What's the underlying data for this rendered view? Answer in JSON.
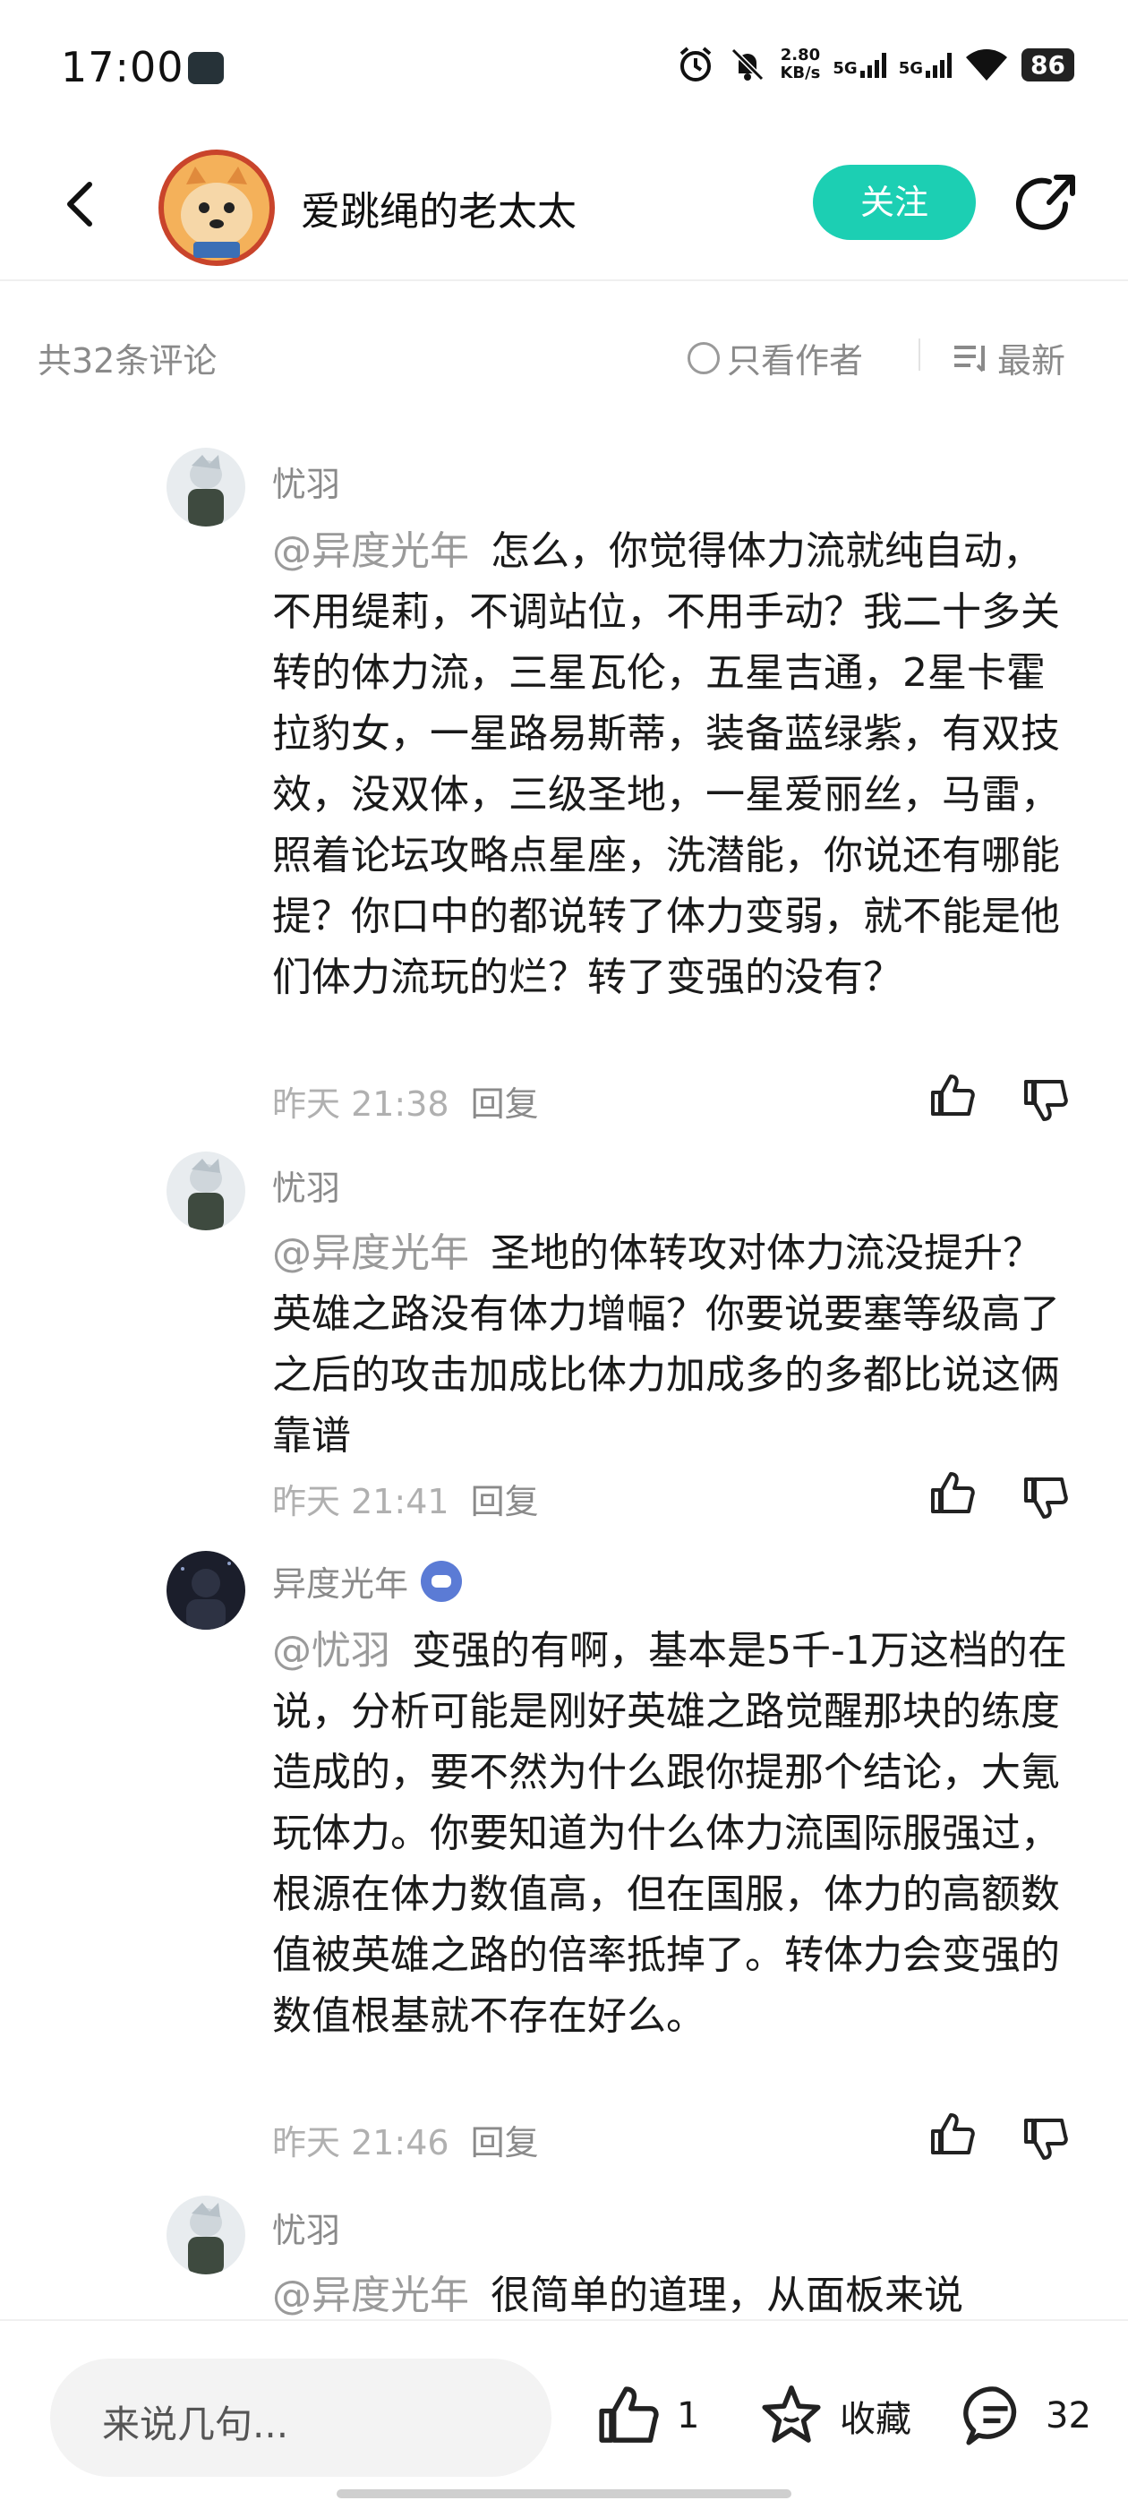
{
  "status_bar": {
    "time": "17:00",
    "speed_value": "2.80",
    "speed_unit": "KB/s",
    "network_1": "5G",
    "network_2": "5G",
    "battery": "86"
  },
  "header": {
    "title": "爱跳绳的老太太",
    "follow_label": "关注"
  },
  "filter": {
    "count": "共32条评论",
    "only_author": "只看作者",
    "sort": "最新"
  },
  "comments": [
    {
      "user": "忧羽",
      "mention": "@异度光年",
      "text": "怎么，你觉得体力流就纯自动，不用缇莉，不调站位，不用手动？我二十多关转的体力流，三星瓦伦，五星吉通，2星卡霍拉豹女，一星路易斯蒂，装备蓝绿紫，有双技效，没双体，三级圣地，一星爱丽丝，马雷，照着论坛攻略点星座，洗潜能，你说还有哪能提？你口中的都说转了体力变弱，就不能是他们体力流玩的烂？转了变强的没有？",
      "time": "昨天 21:38",
      "reply": "回复"
    },
    {
      "user": "忧羽",
      "mention": "@异度光年",
      "text": "圣地的体转攻对体力流没提升？英雄之路没有体力增幅？你要说要塞等级高了之后的攻击加成比体力加成多的多都比说这俩靠谱",
      "time": "昨天 21:41",
      "reply": "回复"
    },
    {
      "user": "异度光年",
      "mention": "@忧羽",
      "text": "变强的有啊，基本是5千-1万这档的在说，分析可能是刚好英雄之路觉醒那块的练度造成的，要不然为什么跟你提那个结论，大氪玩体力。你要知道为什么体力流国际服强过，根源在体力数值高，但在国服，体力的高额数值被英雄之路的倍率抵掉了。转体力会变强的数值根基就不存在好么。",
      "time": "昨天 21:46",
      "reply": "回复"
    },
    {
      "user": "忧羽",
      "mention": "@异度光年",
      "text": "很简单的道理，从面板来说"
    }
  ],
  "bottom": {
    "placeholder": "来说几句...",
    "likes": "1",
    "favorite_label": "收藏",
    "comments_count": "32"
  },
  "colors": {
    "accent": "#1ccfb3",
    "muted_text": "#8a8a8a",
    "mention": "#9a9a9a"
  }
}
